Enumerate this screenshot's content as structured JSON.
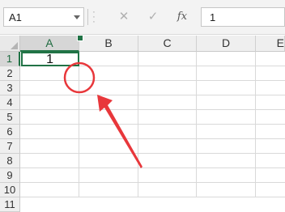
{
  "formula_bar": {
    "name_box": "A1",
    "cancel_icon": "✕",
    "enter_icon": "✓",
    "fx_label": "fx",
    "formula_value": "1"
  },
  "columns": [
    "A",
    "B",
    "C",
    "D",
    "E"
  ],
  "rows": [
    "1",
    "2",
    "3",
    "4",
    "5",
    "6",
    "7",
    "8",
    "9",
    "10",
    "11"
  ],
  "selected_cell": {
    "ref": "A1",
    "value": "1"
  },
  "annotation": {
    "circle_color": "#e8373b",
    "arrow_color": "#e8373b",
    "points_to": "fill-handle"
  },
  "colors": {
    "selection": "#217346"
  }
}
